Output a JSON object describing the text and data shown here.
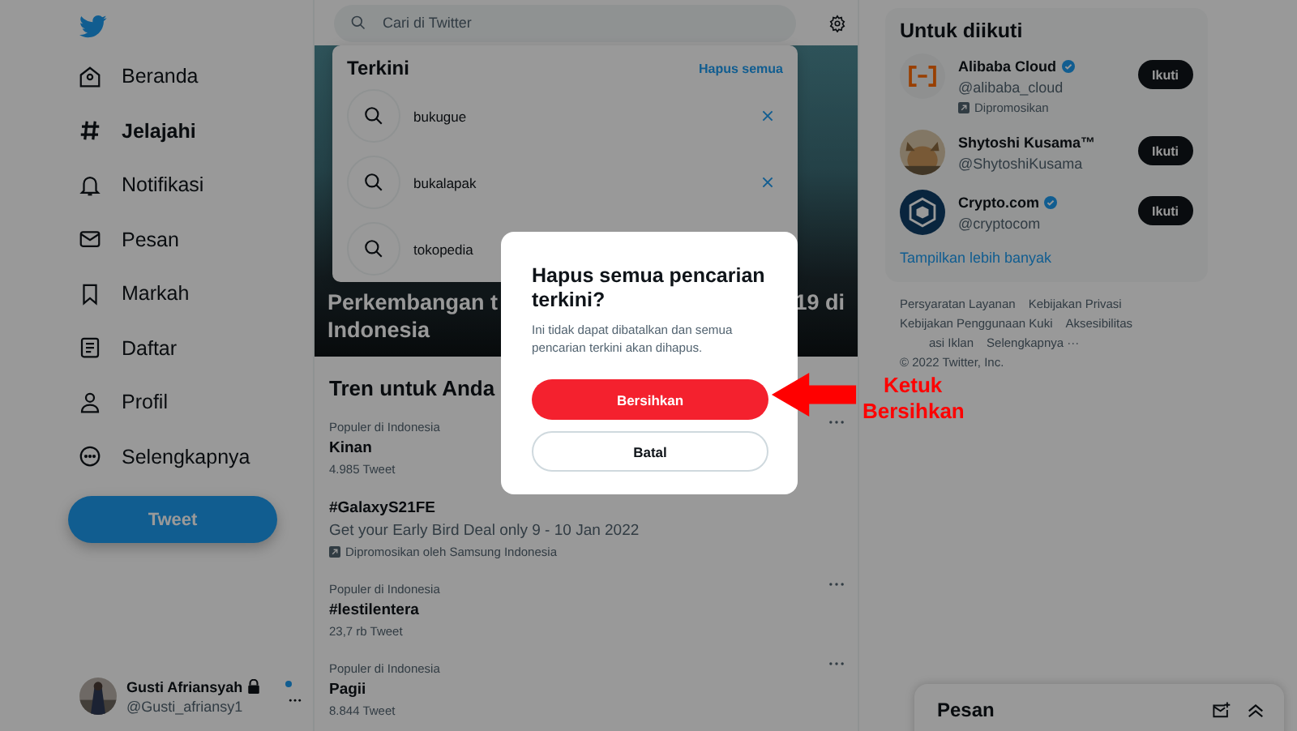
{
  "sidebar": {
    "nav": [
      {
        "label": "Beranda",
        "selected": false
      },
      {
        "label": "Jelajahi",
        "selected": true
      },
      {
        "label": "Notifikasi",
        "selected": false
      },
      {
        "label": "Pesan",
        "selected": false
      },
      {
        "label": "Markah",
        "selected": false
      },
      {
        "label": "Daftar",
        "selected": false
      },
      {
        "label": "Profil",
        "selected": false
      },
      {
        "label": "Selengkapnya",
        "selected": false
      }
    ],
    "tweet_button": "Tweet",
    "account": {
      "name": "Gusti Afriansyah",
      "handle": "@Gusti_afriansy1",
      "locked": true,
      "unread": true
    }
  },
  "search": {
    "placeholder": "Cari di Twitter"
  },
  "recent": {
    "title": "Terkini",
    "clear": "Hapus semua",
    "items": [
      {
        "text": "bukugue",
        "removable": true
      },
      {
        "text": "bukalapak",
        "removable": true
      },
      {
        "text": "tokopedia"
      }
    ]
  },
  "hero": {
    "title_left": "Perkembangan t",
    "title_right": "19 di",
    "title_line2": "Indonesia"
  },
  "trends": {
    "title": "Tren untuk Anda",
    "items": [
      {
        "kind": "trend",
        "context": "Populer di Indonesia",
        "name": "Kinan",
        "count": "4.985 Tweet"
      },
      {
        "kind": "promoted",
        "name": "#GalaxyS21FE",
        "description": "Get your Early Bird Deal only 9 - 10 Jan 2022",
        "promoter": "Dipromosikan oleh Samsung Indonesia"
      },
      {
        "kind": "trend",
        "context": "Populer di Indonesia",
        "name": "#lestilentera",
        "count": "23,7 rb Tweet"
      },
      {
        "kind": "trend",
        "context": "Populer di Indonesia",
        "name": "Pagii",
        "count": "8.844 Tweet"
      }
    ]
  },
  "who_to_follow": {
    "title": "Untuk diikuti",
    "accounts": [
      {
        "name": "Alibaba Cloud",
        "handle": "@alibaba_cloud",
        "verified": true,
        "promoted": "Dipromosikan",
        "button": "Ikuti"
      },
      {
        "name": "Shytoshi Kusama™",
        "handle": "@ShytoshiKusama",
        "verified": false,
        "button": "Ikuti"
      },
      {
        "name": "Crypto.com",
        "handle": "@cryptocom",
        "verified": true,
        "button": "Ikuti"
      }
    ],
    "more": "Tampilkan lebih banyak"
  },
  "footer": {
    "rows": [
      [
        "Persyaratan Layanan",
        "Kebijakan Privasi"
      ],
      [
        "Kebijakan Penggunaan Kuki",
        "Aksesibilitas"
      ],
      [
        "asi Iklan",
        "Selengkapnya ···"
      ]
    ],
    "copyright": "© 2022 Twitter, Inc."
  },
  "messages": {
    "title": "Pesan"
  },
  "dialog": {
    "title": "Hapus semua pencarian terkini?",
    "body": "Ini tidak dapat dibatalkan dan semua pencarian terkini akan dihapus.",
    "confirm": "Bersihkan",
    "cancel": "Batal"
  },
  "annotation": {
    "lines": [
      "Ketuk",
      "Bersihkan"
    ]
  }
}
